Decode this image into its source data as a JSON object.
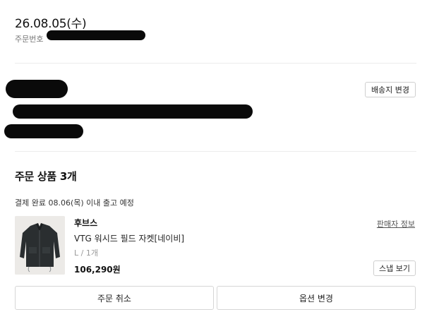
{
  "order": {
    "date": "26.08.05(수)",
    "number_label": "주문번호"
  },
  "shipping": {
    "change_address_label": "배송지 변경"
  },
  "products": {
    "title": "주문 상품 3개",
    "payment_status": "결제 완료 08.06(목) 이내 출고 예정",
    "item": {
      "brand": "후브스",
      "seller_info_label": "판매자 정보",
      "name": "VTG 워시드 필드 자켓[네이비]",
      "option": "L / 1개",
      "price": "106,290원",
      "snap_view_label": "스냅 보기",
      "image_icon": "jacket-icon"
    }
  },
  "actions": {
    "cancel_label": "주문 취소",
    "change_option_label": "옵션 변경"
  }
}
